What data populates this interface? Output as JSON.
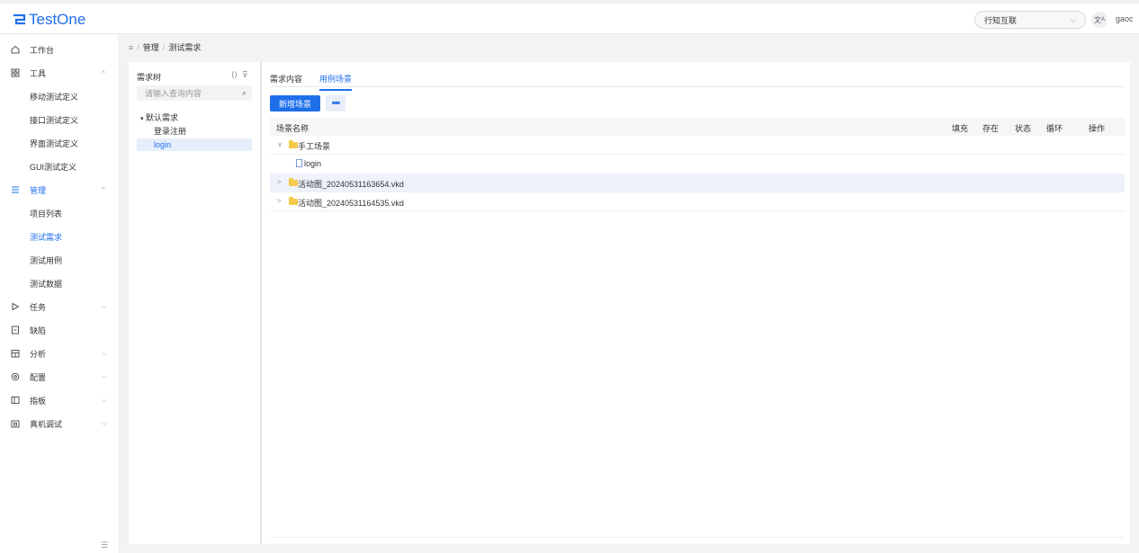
{
  "app": {
    "name": "TestOne",
    "brand_color": "#1f6feb"
  },
  "header": {
    "org_selector": "行知互联",
    "lang_icon": "translate-icon",
    "user": "gaoc"
  },
  "sidebar": {
    "items": [
      {
        "label": "工作台",
        "icon": "home-icon"
      },
      {
        "label": "工具",
        "icon": "grid-icon",
        "arrow": "^"
      },
      {
        "label": "管理",
        "icon": "list-icon",
        "arrow": "^"
      },
      {
        "label": "任务",
        "icon": "play-icon",
        "arrow": "v"
      },
      {
        "label": "缺陷",
        "icon": "bug-icon"
      },
      {
        "label": "分析",
        "icon": "calendar-icon",
        "arrow": "v"
      },
      {
        "label": "配置",
        "icon": "gear-icon",
        "arrow": "v"
      },
      {
        "label": "指板",
        "icon": "panel-icon",
        "arrow": "v"
      },
      {
        "label": "真机调试",
        "icon": "device-icon",
        "arrow": "v"
      }
    ],
    "tools_children": [
      "移动测试定义",
      "接口测试定义",
      "界面测试定义",
      "GUI测试定义"
    ],
    "manage_children": [
      "项目列表",
      "测试需求",
      "测试用例",
      "测试数据"
    ],
    "active_child": "测试需求"
  },
  "breadcrumb": {
    "level1": "管理",
    "level2": "测试需求",
    "separator": "/"
  },
  "tree": {
    "title": "需求树",
    "search_placeholder": "请输入查询内容",
    "root": "默认需求",
    "children": [
      "登录注册",
      "login"
    ],
    "selected": "login"
  },
  "tabs": [
    "需求内容",
    "用例场景"
  ],
  "active_tab": "用例场景",
  "toolbar": {
    "add_label": "新增场景",
    "more_label": "•••"
  },
  "grid": {
    "columns": [
      "场景名称",
      "填充",
      "存在",
      "状态",
      "循环",
      "操作"
    ],
    "rows": [
      {
        "type": "folder",
        "expanded": true,
        "toggle": "∨",
        "name": "手工场景"
      },
      {
        "type": "file",
        "name": "login"
      },
      {
        "type": "folder",
        "expanded": false,
        "toggle": ">",
        "name": "活动图_20240531163654.vkd"
      },
      {
        "type": "folder",
        "expanded": false,
        "toggle": ">",
        "name": "活动图_20240531164535.vkd"
      }
    ]
  }
}
